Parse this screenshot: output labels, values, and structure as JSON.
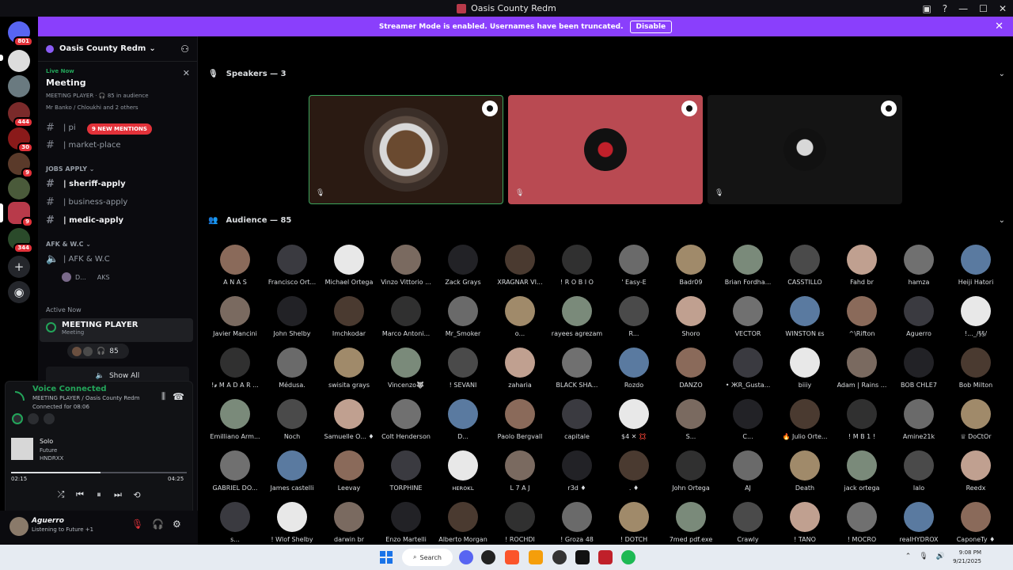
{
  "window": {
    "title": "Oasis County Redm"
  },
  "banner": {
    "text": "Streamer Mode is enabled. Usernames have been truncated.",
    "button": "Disable"
  },
  "servers": {
    "badges": [
      "801",
      "444",
      "30",
      "9",
      "9",
      "9",
      "344"
    ]
  },
  "guild": {
    "name": "Oasis County Redm"
  },
  "live": {
    "label": "Live Now",
    "title": "Meeting",
    "sub": "MEETING PLAYER · 🎧 85 in audience",
    "members": "Mr Banko / Chloukhi and 2 others"
  },
  "channels": {
    "pinned": "| pi",
    "mentions": "9 NEW MENTIONS",
    "market": "| market-place",
    "jobs_cat": "JOBS APPLY",
    "sheriff": "| sheriff-apply",
    "business": "| business-apply",
    "medic": "| medic-apply",
    "afk_cat": "AFK & W.C",
    "afk": "| AFK & W.C",
    "afk_user1": "D...",
    "afk_user2": "AKS"
  },
  "active_now": {
    "label": "Active Now",
    "name": "MEETING PLAYER",
    "sub": "Meeting",
    "count": "85",
    "show_all": "Show All"
  },
  "voice": {
    "status": "Voice Connected",
    "channel": "MEETING PLAYER / Oasis County Redm",
    "time": "Connected for 08:06"
  },
  "player": {
    "song": "Solo",
    "artist": "Future",
    "album": "HNDRXX",
    "current": "02:15",
    "total": "04:25",
    "progress": 0.51
  },
  "user": {
    "name": "Aguerro",
    "status": "Listening to Future +1"
  },
  "speakers": {
    "label": "Speakers — 3",
    "tiles": [
      {
        "bg": "#2a1a12",
        "border": "#3ba55c"
      },
      {
        "bg": "#b94a52",
        "border": "#b94a52"
      },
      {
        "bg": "#141414",
        "border": "#141414"
      }
    ]
  },
  "audience": {
    "label": "Audience — 85",
    "rows": [
      [
        "A N A S",
        "Francisco Ort...",
        "Michael Ortega",
        "Vinzo Vittorio ...",
        "Zack Grays",
        "XRAGNAR VI...",
        "! R O B I O",
        "' Easy-E",
        "Badr09",
        "Brian Fordha...",
        "CASSTILLO",
        "Fahd br",
        "hamza",
        "Heiji Hatori"
      ],
      [
        "Javier Mancini",
        "John Shelby",
        "Imchkodar",
        "Marco Antoni...",
        "Mr_Smoker",
        "o...",
        "rayees agrezam",
        "R...",
        "Shoro",
        "VECTOR",
        "WINSTON ᴇs",
        "^\\Rifton",
        "Aguerro",
        "!..._/§§/"
      ],
      [
        "!҂ M A D A R ...",
        "Médusa.",
        "swisita grays",
        "Vincenzo🐺",
        "! SEVANI",
        "zaharia",
        "BLACK SHA...",
        "Rozdo",
        "DANZO",
        "• ЖR_Gusta...",
        "biiiy",
        "Adam | Rains ...",
        "BOB CHLE7",
        "Bob Milton"
      ],
      [
        "Emilliano Arm...",
        "Noch",
        "Samuelle O... ♦",
        "Colt Henderson",
        "D...",
        "Paolo Bergvall",
        "capitale",
        "$4 ✕ 💢",
        "S...",
        "C...",
        "🔥 Julio Orte...",
        "! M B 1 !",
        "Amine21k",
        "♕ DoCtOr"
      ],
      [
        "GABRIEL DO...",
        "James castelli",
        "Leevay",
        "TORPHINE",
        "ʜᴇʀᴏᴋʟ",
        "L 7 A J",
        "r3d ♦",
        ". ♦",
        "John Ortega",
        "AJ",
        "Death",
        "jack ortega",
        "lalo",
        "Reedx"
      ],
      [
        "s...",
        "! Wlof Shelby",
        "darwin br",
        "Enzo Martelli",
        "Alberto Morgan",
        "! ROCHDI",
        "! Groza 48",
        "! DOTCH",
        "7med pdf.exe",
        "Crawly",
        "! TANO",
        "! MOCRO",
        "realHYDROX",
        "CaponeTy ♦"
      ]
    ],
    "colors": [
      "#8a6a5a",
      "#3a3a40",
      "#e8e8e8",
      "#7a6a60",
      "#222226",
      "#4a3a30",
      "#303030",
      "#6a6a6a",
      "#a08a6a",
      "#7a8a7a",
      "#4a4a4a",
      "#c0a090",
      "#707070",
      "#5a7aa0"
    ]
  },
  "taskbar": {
    "search": "Search",
    "time": "9:08 PM",
    "date": "9/21/2025"
  }
}
